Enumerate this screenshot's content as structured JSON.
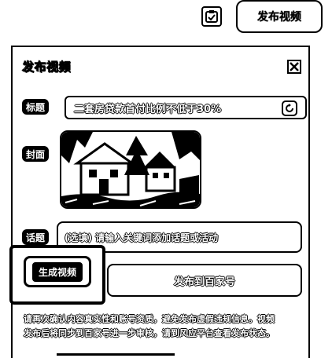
{
  "topbar": {
    "icon": "checkbox-icon",
    "publish_label": "发布视频"
  },
  "dialog": {
    "title": "发布视频",
    "close_icon": "close-icon",
    "title_label": "标题",
    "title_value": "二套房贷款首付比例不低于30%",
    "refresh_icon": "refresh-icon",
    "cover_label": "封面",
    "topic_label": "话题",
    "topic_placeholder": "(选填) 请输入关键词添加话题或活动",
    "generate_button": "生成视频",
    "publish_button": "发布到百家号",
    "notice_line1": "请再次确认内容真实性和账号资质，避免发布虚假违规信息。视频",
    "notice_line2": "发布后将同步到百家号进一步审核，请到风应平台查看发布状态。"
  }
}
